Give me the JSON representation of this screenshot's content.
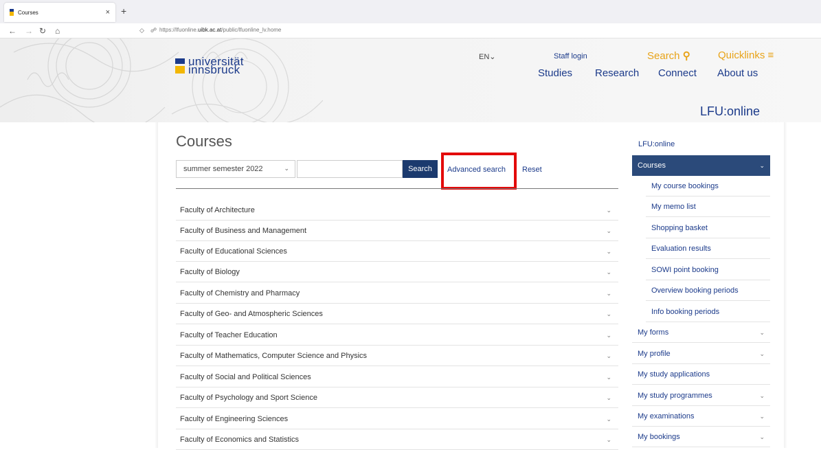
{
  "browser": {
    "tab_title": "Courses",
    "tab_close": "×",
    "new_tab": "+",
    "url_prefix": "https://lfuonline.",
    "url_domain": "uibk.ac.at",
    "url_path": "/public/lfuonline_lv.home"
  },
  "header": {
    "logo_line1": "universität",
    "logo_line2": "innsbruck",
    "lang": "EN⌄",
    "staff_login": "Staff login",
    "search": "Search",
    "quicklinks": "Quicklinks",
    "nav": [
      "Studies",
      "Research",
      "Connect",
      "About us"
    ],
    "section": "LFU:online"
  },
  "main": {
    "title": "Courses",
    "semester": "summer semester 2022",
    "search_value": "",
    "search_button": "Search",
    "advanced_search": "Advanced search",
    "reset": "Reset",
    "faculties": [
      "Faculty of Architecture",
      "Faculty of Business and Management",
      "Faculty of Educational Sciences",
      "Faculty of Biology",
      "Faculty of Chemistry and Pharmacy",
      "Faculty of Geo- and Atmospheric Sciences",
      "Faculty of Teacher Education",
      "Faculty of Mathematics, Computer Science and Physics",
      "Faculty of Social and Political Sciences",
      "Faculty of Psychology and Sport Science",
      "Faculty of Engineering Sciences",
      "Faculty of Economics and Statistics"
    ]
  },
  "sidebar": {
    "heading": "LFU:online",
    "active": "Courses",
    "sub_items": [
      "My course bookings",
      "My memo list",
      "Shopping basket",
      "Evaluation results",
      "SOWI point booking",
      "Overview booking periods",
      "Info booking periods"
    ],
    "items": [
      {
        "label": "My forms",
        "expandable": true
      },
      {
        "label": "My profile",
        "expandable": true
      },
      {
        "label": "My study applications",
        "expandable": false
      },
      {
        "label": "My study programmes",
        "expandable": true
      },
      {
        "label": "My examinations",
        "expandable": true
      },
      {
        "label": "My bookings",
        "expandable": true
      }
    ]
  },
  "colors": {
    "brand_blue": "#1b3a8a",
    "brand_yellow": "#f2b705",
    "accent_orange": "#e8a318",
    "active_bg": "#2b4a7a",
    "highlight_red": "#e30b0b"
  }
}
